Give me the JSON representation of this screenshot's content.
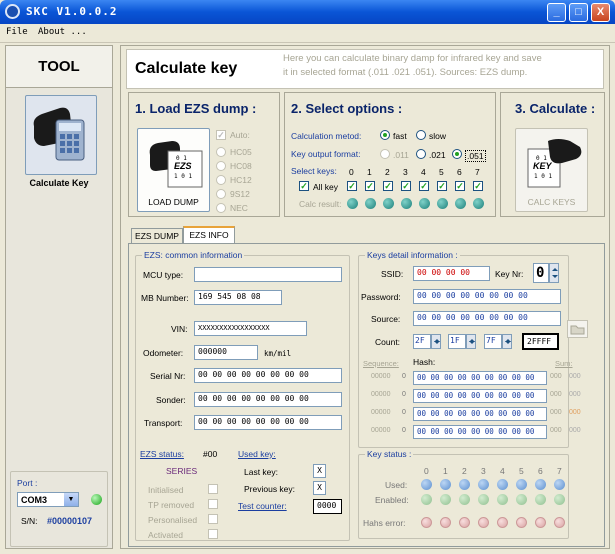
{
  "window": {
    "title": "SKC  V1.0.0.2",
    "minimize": "_",
    "maximize": "□",
    "close": "X"
  },
  "menu": {
    "file": "File",
    "about": "About ..."
  },
  "tool": {
    "title": "TOOL",
    "calc_label": "Calculate Key"
  },
  "port": {
    "label": "Port :",
    "value": "COM3",
    "sn_label": "S/N:",
    "sn_value": "#00000107"
  },
  "header": {
    "title": "Calculate key",
    "line1": "Here you can calculate binary damp for infrared key and save",
    "line2": "it in selected format (.011 .021 .051). Sources:  EZS dump."
  },
  "step1": {
    "title": "1. Load EZS dump :",
    "button": "LOAD DUMP",
    "auto": "Auto:",
    "icon_text": "EZS",
    "icon_bits": "0 1",
    "icon_bits2": "1 0 1",
    "options": [
      "HC05",
      "HC08",
      "HC12",
      "9S12",
      "NEC"
    ]
  },
  "step2": {
    "title": "2. Select options :",
    "metod_label": "Calculation metod:",
    "fast": "fast",
    "slow": "slow",
    "format_label": "Key output format:",
    "f011": ".011",
    "f021": ".021",
    "f051": ".051",
    "select_keys": "Select keys:",
    "all_key": "All key",
    "calc_result": "Calc result:",
    "key_nums": [
      "0",
      "1",
      "2",
      "3",
      "4",
      "5",
      "6",
      "7"
    ]
  },
  "step3": {
    "title": "3. Calculate :",
    "button": "CALC KEYS",
    "icon_text": "KEY",
    "icon_bits": "0 1",
    "icon_bits2": "1 0 1"
  },
  "tabs": {
    "dump": "EZS DUMP",
    "info": "EZS INFO"
  },
  "ezs": {
    "legend": "EZS: common information",
    "mcu_label": "MCU type:",
    "mcu_value": "",
    "mb_label": "MB Number:",
    "mb_value": "169 545 08 08",
    "vin_label": "VIN:",
    "vin_value": "XXXXXXXXXXXXXXXXX",
    "odo_label": "Odometer:",
    "odo_value": "000000",
    "odo_unit": "km/mil",
    "serial_label": "Serial Nr:",
    "serial_value": "00 00 00 00 00 00 00 00",
    "sonder_label": "Sonder:",
    "sonder_value": "00 00 00 00 00 00 00 00",
    "transport_label": "Transport:",
    "transport_value": "00 00 00 00 00 00 00 00",
    "status_label": "EZS status:",
    "status_code": "#00",
    "status_value": "SERIES",
    "flags": [
      "Initialised",
      "TP removed",
      "Personalised",
      "Activated"
    ],
    "used_key_label": "Used key:",
    "last_key_label": "Last key:",
    "last_key_value": "X",
    "prev_key_label": "Previous key:",
    "prev_key_value": "X",
    "test_counter_label": "Test counter:",
    "test_counter_value": "0000"
  },
  "keys": {
    "legend": "Keys detail information :",
    "ssid_label": "SSID:",
    "ssid_value": "00 00 00 00",
    "keynr_label": "Key Nr:",
    "keynr_value": "0",
    "password_label": "Password:",
    "password_value": "00 00 00 00 00 00 00 00",
    "source_label": "Source:",
    "source_value": "00 00 00 00 00 00 00 00",
    "count_label": "Count:",
    "count1": "2F",
    "count2": "1F",
    "count3": "7F",
    "count4": "2FFFF",
    "seq_label": "Sequence:",
    "hash_label": "Hash:",
    "sum_label": "Sum:",
    "seq_values": [
      "00000",
      "00000",
      "00000",
      "00000"
    ],
    "seq_idx": [
      "0",
      "0",
      "0",
      "0"
    ],
    "hash_values": [
      "00 00 00 00 00 00 00 00 00",
      "00 00 00 00 00 00 00 00 00",
      "00 00 00 00 00 00 00 00 00",
      "00 00 00 00 00 00 00 00 00"
    ],
    "sum_a": [
      "000",
      "000",
      "000",
      "000"
    ],
    "sum_b": [
      "000",
      "000",
      "000",
      "000"
    ]
  },
  "keystatus": {
    "legend": "Key status :",
    "nums": [
      "0",
      "1",
      "2",
      "3",
      "4",
      "5",
      "6",
      "7"
    ],
    "used": "Used:",
    "enabled": "Enabled:",
    "hash_error": "Hahs error:"
  }
}
